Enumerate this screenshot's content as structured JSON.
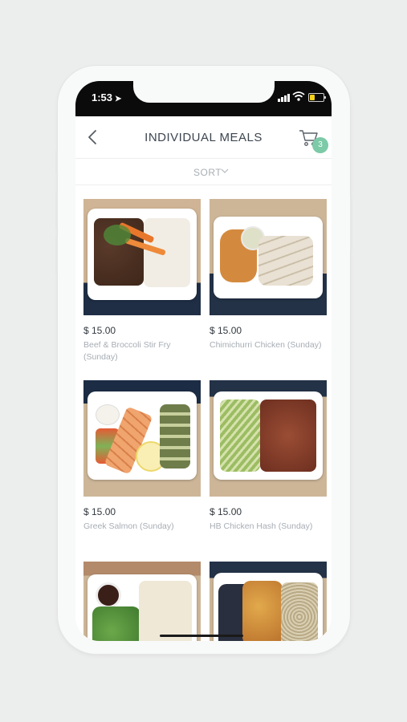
{
  "status": {
    "time": "1:53",
    "location_icon": "location-arrow-icon"
  },
  "header": {
    "title": "INDIVIDUAL MEALS",
    "back_icon": "back-chevron-icon",
    "cart_icon": "cart-icon",
    "cart_count": "3"
  },
  "sort": {
    "label": "SORT",
    "icon": "chevron-down-icon"
  },
  "meals": [
    {
      "price": "$ 15.00",
      "name": "Beef & Broccoli Stir Fry (Sunday)"
    },
    {
      "price": "$ 15.00",
      "name": "Chimichurri Chicken (Sunday)"
    },
    {
      "price": "$ 15.00",
      "name": "Greek Salmon (Sunday)"
    },
    {
      "price": "$ 15.00",
      "name": "HB Chicken Hash (Sunday)"
    },
    {
      "price": "",
      "name": ""
    },
    {
      "price": "",
      "name": ""
    }
  ],
  "colors": {
    "accent": "#7ccaa7",
    "title": "#3d4650",
    "muted": "#a7adb4"
  }
}
